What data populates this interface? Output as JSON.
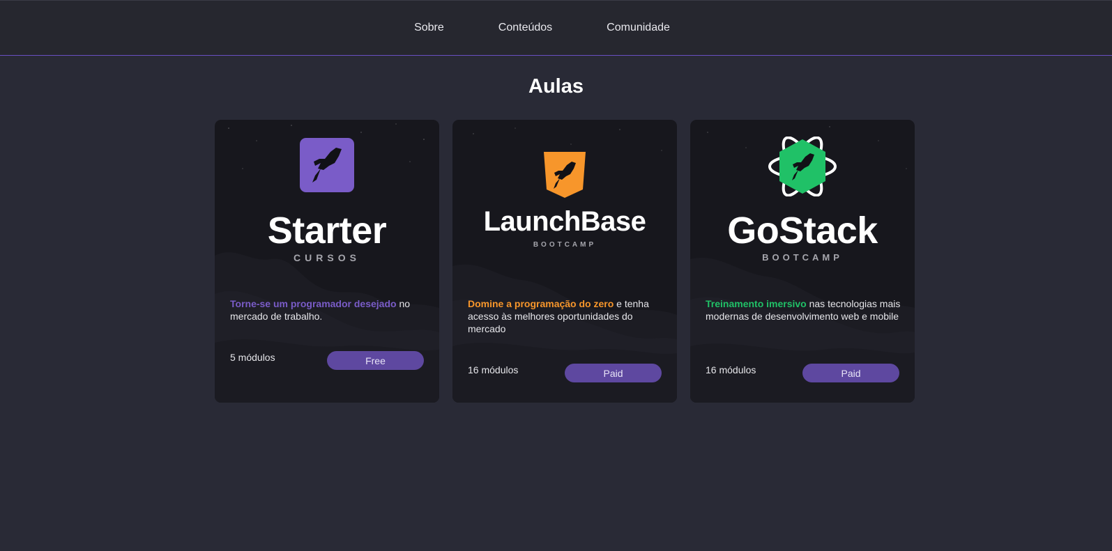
{
  "nav": {
    "items": [
      "Sobre",
      "Conteúdos",
      "Comunidade"
    ]
  },
  "page_title": "Aulas",
  "colors": {
    "starter": "#7a5cc8",
    "launchbase": "#f7962b",
    "gostack": "#20c167",
    "button": "#5e48a0"
  },
  "cards": [
    {
      "icon": "rocket-square-icon",
      "name": "Starter",
      "sub": "CURSOS",
      "highlight": "Torne-se um programador desejado",
      "rest": " no mercado de trabalho.",
      "modules": "5 módulos",
      "price": "Free"
    },
    {
      "icon": "rocket-shield-icon",
      "name": "LaunchBase",
      "sub": "BOOTCAMP",
      "highlight": "Domine a programação do zero",
      "rest": " e tenha acesso às melhores oportunidades do mercado",
      "modules": "16 módulos",
      "price": "Paid"
    },
    {
      "icon": "rocket-atom-icon",
      "name": "GoStack",
      "sub": "BOOTCAMP",
      "highlight": "Treinamento imersivo",
      "rest": " nas tecnologias mais modernas de desenvolvimento web e mobile",
      "modules": "16 módulos",
      "price": "Paid"
    }
  ]
}
